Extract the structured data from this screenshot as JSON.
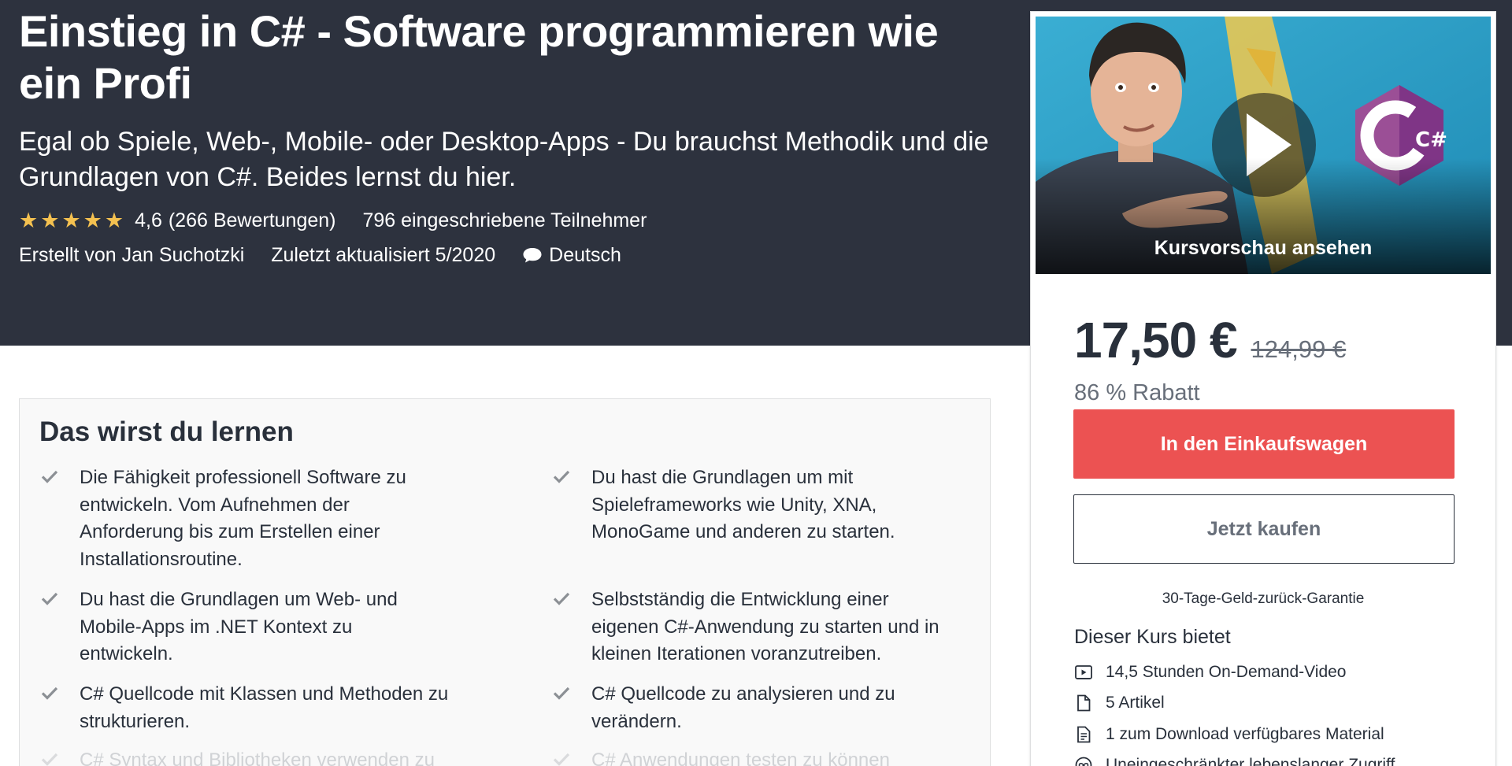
{
  "course": {
    "title": "Einstieg in C# - Software programmieren wie ein Profi",
    "subtitle": "Egal ob Spiele, Web-, Mobile- oder Desktop-Apps - Du brauchst Methodik und die Grundlagen von C#. Beides lernst du hier.",
    "rating_stars": 4.6,
    "rating_value": "4,6",
    "rating_count": "(266 Bewertungen)",
    "students": "796 eingeschriebene Teilnehmer",
    "author": "Erstellt von Jan Suchotzki",
    "updated": "Zuletzt aktualisiert 5/2020",
    "language": "Deutsch"
  },
  "learn": {
    "title": "Das wirst du lernen",
    "left": [
      "Die Fähigkeit professionell Software zu entwickeln. Vom Aufnehmen der Anforderung bis zum Erstellen einer Installationsroutine.",
      "Du hast die Grundlagen um Web- und Mobile-Apps im .NET Kontext zu entwickeln.",
      "C# Quellcode mit Klassen und Methoden zu strukturieren.",
      "C# Syntax und Bibliotheken verwenden zu"
    ],
    "right": [
      "Du hast die Grundlagen um mit Spieleframeworks wie Unity, XNA, MonoGame und anderen zu starten.",
      "Selbstständig die Entwicklung einer eigenen C#-Anwendung zu starten und in kleinen Iterationen voranzutreiben.",
      "C# Quellcode zu analysieren und zu verändern.",
      "C# Anwendungen testen zu können"
    ]
  },
  "sidebar": {
    "preview_label": "Kursvorschau ansehen",
    "preview_logo": "C#",
    "price": "17,50 €",
    "old_price": "124,99 €",
    "discount": "86 % Rabatt",
    "cart_button": "In den Einkaufswagen",
    "buy_button": "Jetzt kaufen",
    "guarantee": "30-Tage-Geld-zurück-Garantie",
    "includes_title": "Dieser Kurs bietet",
    "includes": [
      {
        "icon": "video-icon",
        "label": "14,5 Stunden On-Demand-Video"
      },
      {
        "icon": "file-icon",
        "label": "5 Artikel"
      },
      {
        "icon": "download-file-icon",
        "label": "1 zum Download verfügbares Material"
      },
      {
        "icon": "infinity-icon",
        "label": "Uneingeschränkter lebenslanger Zugriff"
      }
    ]
  },
  "colors": {
    "hero_bg": "#2d323e",
    "star": "#f4c150",
    "cart_button": "#ec5252",
    "preview_bg": "#2aa2c8"
  }
}
